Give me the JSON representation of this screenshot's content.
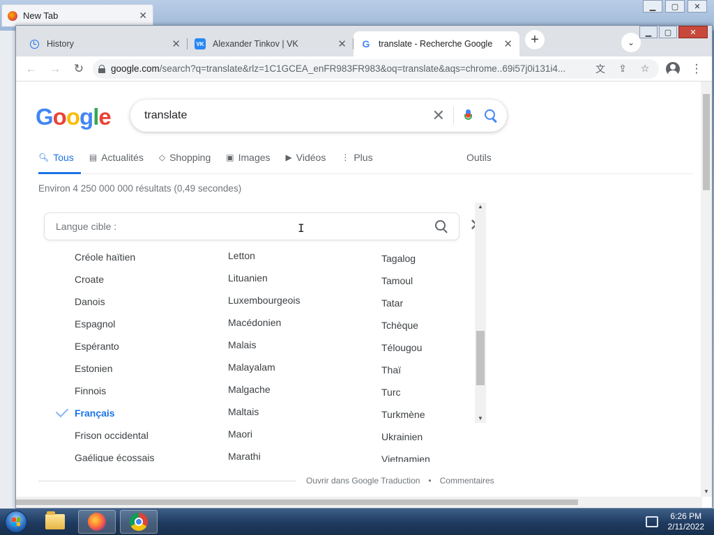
{
  "background_window": {
    "tab_title": "New Tab",
    "close": "✕"
  },
  "chrome": {
    "tabs": [
      {
        "title": "History",
        "icon": "history-icon",
        "active": false
      },
      {
        "title": "Alexander Tinkov | VK",
        "icon": "vk-icon",
        "active": false
      },
      {
        "title": "translate - Recherche Google",
        "icon": "google-icon",
        "active": true
      }
    ],
    "new_tab": "+",
    "tab_close": "✕",
    "tab_search": "⌄",
    "window_controls": {
      "minimize": "▁",
      "maximize": "▢",
      "close": "✕"
    },
    "toolbar": {
      "back": "←",
      "forward": "→",
      "reload": "↻",
      "url_host": "google.com",
      "url_path": "/search?q=translate&rlz=1C1GCEA_enFR983FR983&oq=translate&aqs=chrome..69i57j0i131i4...",
      "translate_icon": "translate-icon",
      "share": "⇪",
      "bookmark": "☆",
      "menu": "⋮"
    }
  },
  "google": {
    "logo": {
      "G": "G",
      "o1": "o",
      "o2": "o",
      "g": "g",
      "l": "l",
      "e": "e"
    },
    "query": "translate",
    "clear": "✕",
    "nav": {
      "tous": "Tous",
      "actualites": "Actualités",
      "shopping": "Shopping",
      "images": "Images",
      "videos": "Vidéos",
      "plus": "Plus",
      "outils": "Outils"
    },
    "stats": "Environ 4 250 000 000 résultats (0,49 secondes)",
    "language_picker": {
      "placeholder": "Langue cible :",
      "close": "✕",
      "columns": [
        [
          "Créole haïtien",
          "Croate",
          "Danois",
          "Espagnol",
          "Espéranto",
          "Estonien",
          "Finnois",
          "Français",
          "Frison occidental",
          "Gaélique écossais"
        ],
        [
          "Letton",
          "Lituanien",
          "Luxembourgeois",
          "Macédonien",
          "Malais",
          "Malayalam",
          "Malgache",
          "Maltais",
          "Maori",
          "Marathi"
        ],
        [
          "Tagalog",
          "Tamoul",
          "Tatar",
          "Tchèque",
          "Télougou",
          "Thaï",
          "Turc",
          "Turkmène",
          "Ukrainien",
          "Vietnamien"
        ]
      ],
      "selected": "Français",
      "footer_link_1": "Ouvrir dans Google Traduction",
      "footer_sep": "•",
      "footer_link_2": "Commentaires"
    }
  },
  "taskbar": {
    "time": "6:26 PM",
    "date": "2/11/2022"
  }
}
